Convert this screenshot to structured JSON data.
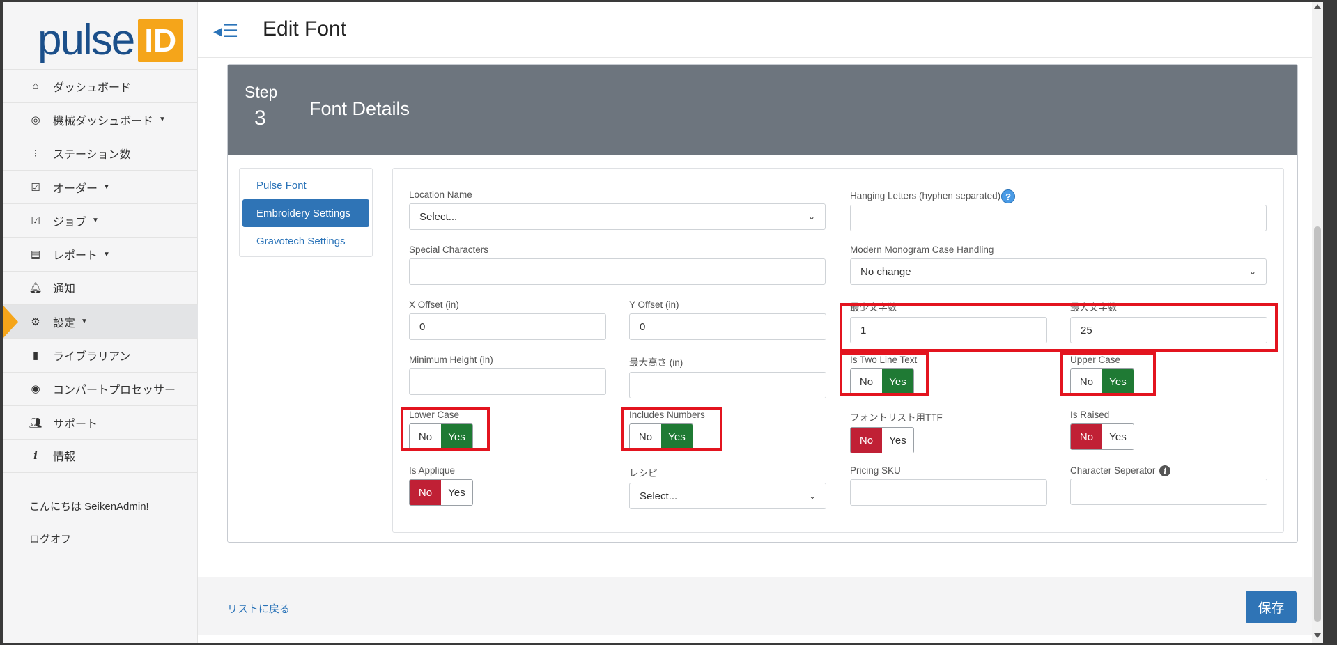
{
  "logo": {
    "text": "pulse",
    "badge": "ID"
  },
  "header": {
    "title": "Edit Font"
  },
  "sidebar": {
    "items": [
      {
        "label": "ダッシュボード",
        "icon": "home-icon",
        "caret": false
      },
      {
        "label": "機械ダッシュボード",
        "icon": "gauge-icon",
        "caret": true
      },
      {
        "label": "ステーション数",
        "icon": "station-icon",
        "caret": false
      },
      {
        "label": "オーダー",
        "icon": "checkbox-icon",
        "caret": true
      },
      {
        "label": "ジョブ",
        "icon": "checkbox-icon",
        "caret": true
      },
      {
        "label": "レポート",
        "icon": "table-icon",
        "caret": true
      },
      {
        "label": "通知",
        "icon": "bell-icon",
        "caret": false
      },
      {
        "label": "設定",
        "icon": "gear-icon",
        "caret": true,
        "active": true
      },
      {
        "label": "ライブラリアン",
        "icon": "book-icon",
        "caret": false
      },
      {
        "label": "コンバートプロセッサー",
        "icon": "target-icon",
        "caret": false
      },
      {
        "label": "サポート",
        "icon": "users-icon",
        "caret": false
      },
      {
        "label": "情報",
        "icon": "info-icon",
        "caret": false
      }
    ],
    "greeting": "こんにちは SeikenAdmin!",
    "logoff": "ログオフ"
  },
  "step": {
    "label": "Step",
    "number": "3",
    "title": "Font Details"
  },
  "tabs": [
    {
      "label": "Pulse Font",
      "active": false
    },
    {
      "label": "Embroidery Settings",
      "active": true
    },
    {
      "label": "Gravotech Settings",
      "active": false
    }
  ],
  "form": {
    "location_name": {
      "label": "Location Name",
      "value": "Select..."
    },
    "hanging_letters": {
      "label": "Hanging Letters (hyphen separated)",
      "value": ""
    },
    "special_characters": {
      "label": "Special Characters",
      "value": ""
    },
    "monogram_case": {
      "label": "Modern Monogram Case Handling",
      "value": "No change"
    },
    "x_offset": {
      "label": "X Offset (in)",
      "value": "0"
    },
    "y_offset": {
      "label": "Y Offset (in)",
      "value": "0"
    },
    "min_chars": {
      "label": "最少文字数",
      "value": "1"
    },
    "max_chars": {
      "label": "最大文字数",
      "value": "25"
    },
    "min_height": {
      "label": "Minimum Height (in)",
      "value": ""
    },
    "max_height": {
      "label": "最大高さ (in)",
      "value": ""
    },
    "two_line": {
      "label": "Is Two Line Text",
      "selected": "Yes"
    },
    "upper_case": {
      "label": "Upper Case",
      "selected": "Yes"
    },
    "lower_case": {
      "label": "Lower Case",
      "selected": "Yes"
    },
    "includes_numbers": {
      "label": "Includes Numbers",
      "selected": "Yes"
    },
    "font_list_ttf": {
      "label": "フォントリスト用TTF",
      "selected": "No"
    },
    "is_raised": {
      "label": "Is Raised",
      "selected": "No"
    },
    "is_applique": {
      "label": "Is Applique",
      "selected": "No"
    },
    "recipe": {
      "label": "レシピ",
      "value": "Select..."
    },
    "pricing_sku": {
      "label": "Pricing SKU",
      "value": ""
    },
    "char_separator": {
      "label": "Character Seperator",
      "value": ""
    },
    "no_label": "No",
    "yes_label": "Yes"
  },
  "footer": {
    "back_link": "リストに戻る",
    "save_label": "保存"
  },
  "colors": {
    "primary": "#2f74b6",
    "yes": "#1f7a34",
    "no": "#c02035",
    "accent": "#f5a51a",
    "highlight": "#e3141f"
  }
}
